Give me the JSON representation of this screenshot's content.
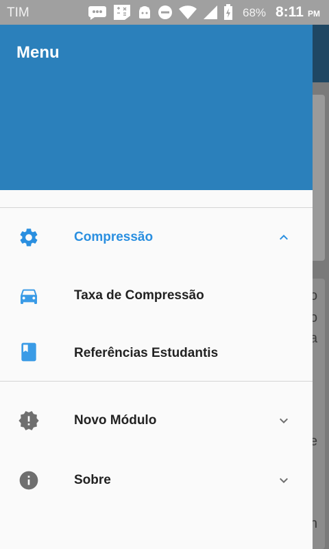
{
  "status_bar": {
    "carrier": "TIM",
    "battery_percent": "68%",
    "time": "8:11",
    "ampm": "PM",
    "icons": [
      "chat-icon",
      "sim-toolkit-icon",
      "android-icon",
      "do-not-disturb-icon",
      "wifi-icon",
      "signal-icon",
      "battery-charging-icon"
    ]
  },
  "background_app": {
    "visible_chars": [
      "o",
      "o",
      "a",
      "e",
      "n"
    ]
  },
  "drawer": {
    "title": "Menu",
    "accent_color": "#2b80bb",
    "active_color": "#2a8fe0",
    "sections": [
      {
        "label": "Compressão",
        "icon": "gear-icon",
        "expanded": true,
        "children": [
          {
            "label": "Taxa de Compressão",
            "icon": "car-icon"
          },
          {
            "label": "Referências Estudantis",
            "icon": "book-icon"
          }
        ]
      },
      {
        "label": "Novo Módulo",
        "icon": "alert-badge-icon",
        "expanded": false
      },
      {
        "label": "Sobre",
        "icon": "info-icon",
        "expanded": false
      }
    ]
  }
}
